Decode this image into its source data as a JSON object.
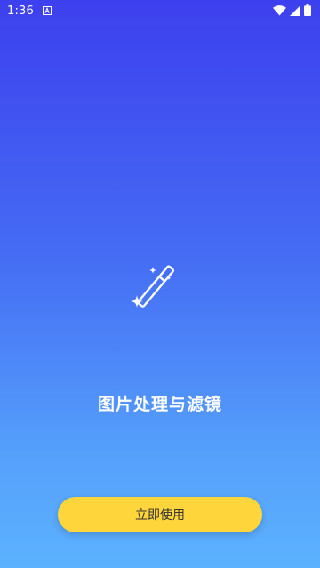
{
  "status_bar": {
    "time": "1:36",
    "notification_icon": "font-a-icon",
    "right_icons": [
      "wifi-icon",
      "signal-icon",
      "battery-icon"
    ]
  },
  "hero": {
    "icon": "magic-wand-icon",
    "title": "图片处理与滤镜"
  },
  "start_button": {
    "label": "立即使用"
  },
  "colors": {
    "gradient_top": "#3d40ee",
    "gradient_bottom": "#5cb2ff",
    "button_bg": "#fed63b",
    "button_text": "#333333",
    "text_light": "#ffffff"
  }
}
